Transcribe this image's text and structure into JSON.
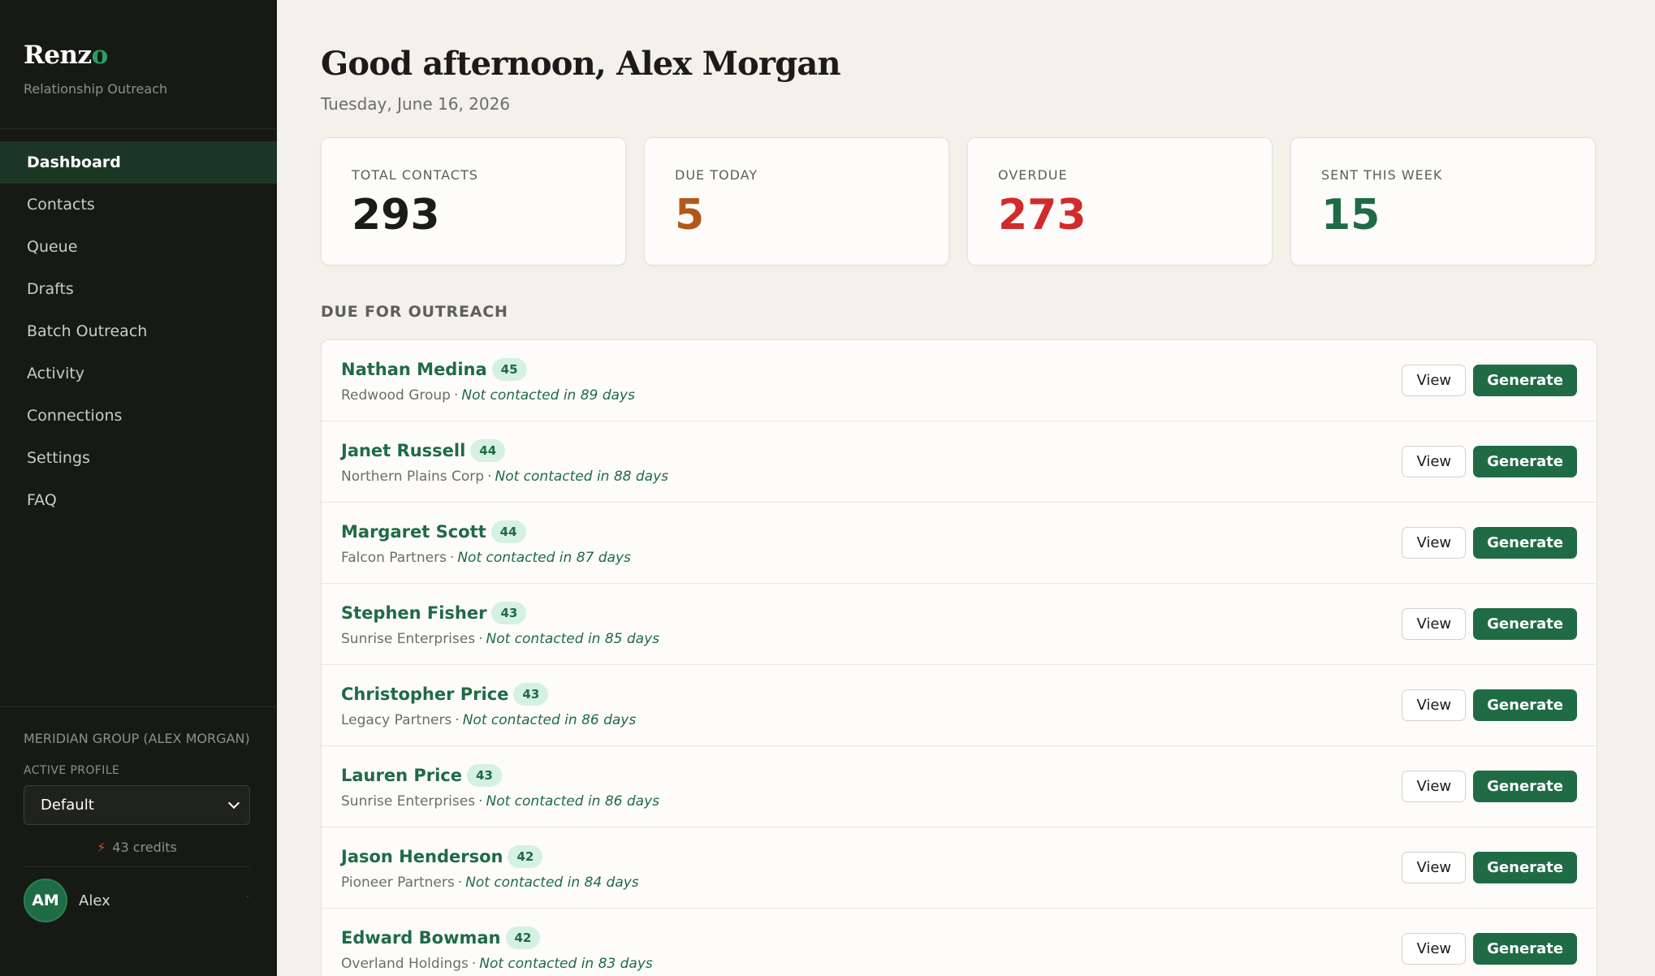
{
  "brand": {
    "name": "Renz",
    "name_accent": "o",
    "tagline": "Relationship Outreach"
  },
  "nav": [
    {
      "label": "Dashboard",
      "active": true
    },
    {
      "label": "Contacts"
    },
    {
      "label": "Queue"
    },
    {
      "label": "Drafts"
    },
    {
      "label": "Batch Outreach"
    },
    {
      "label": "Activity"
    },
    {
      "label": "Connections"
    },
    {
      "label": "Settings"
    },
    {
      "label": "FAQ"
    }
  ],
  "sidebar_footer": {
    "org": "MERIDIAN GROUP (ALEX MORGAN)",
    "profile_label": "ACTIVE PROFILE",
    "profile_value": "Default",
    "credits": "43 credits",
    "avatar_initials": "AM",
    "user_name": "Alex"
  },
  "header": {
    "greeting": "Good afternoon, Alex Morgan",
    "date": "Tuesday, June 16, 2026"
  },
  "stats": [
    {
      "label": "TOTAL CONTACTS",
      "value": "293"
    },
    {
      "label": "DUE TODAY",
      "value": "5"
    },
    {
      "label": "OVERDUE",
      "value": "273"
    },
    {
      "label": "SENT THIS WEEK",
      "value": "15"
    }
  ],
  "section_title": "DUE FOR OUTREACH",
  "buttons": {
    "view": "View",
    "generate": "Generate"
  },
  "contacts": [
    {
      "name": "Nathan Medina",
      "score": "45",
      "company": "Redwood Group",
      "since": "Not contacted in 89 days"
    },
    {
      "name": "Janet Russell",
      "score": "44",
      "company": "Northern Plains Corp",
      "since": "Not contacted in 88 days"
    },
    {
      "name": "Margaret Scott",
      "score": "44",
      "company": "Falcon Partners",
      "since": "Not contacted in 87 days"
    },
    {
      "name": "Stephen Fisher",
      "score": "43",
      "company": "Sunrise Enterprises",
      "since": "Not contacted in 85 days"
    },
    {
      "name": "Christopher Price",
      "score": "43",
      "company": "Legacy Partners",
      "since": "Not contacted in 86 days"
    },
    {
      "name": "Lauren Price",
      "score": "43",
      "company": "Sunrise Enterprises",
      "since": "Not contacted in 86 days"
    },
    {
      "name": "Jason Henderson",
      "score": "42",
      "company": "Pioneer Partners",
      "since": "Not contacted in 84 days"
    },
    {
      "name": "Edward Bowman",
      "score": "42",
      "company": "Overland Holdings",
      "since": "Not contacted in 83 days"
    }
  ],
  "colors": {
    "accent": "#1f6b46",
    "due": "#b4581a",
    "overdue": "#d22a2a",
    "sidebar_bg": "#171915",
    "page_bg": "#f4f0ea"
  }
}
